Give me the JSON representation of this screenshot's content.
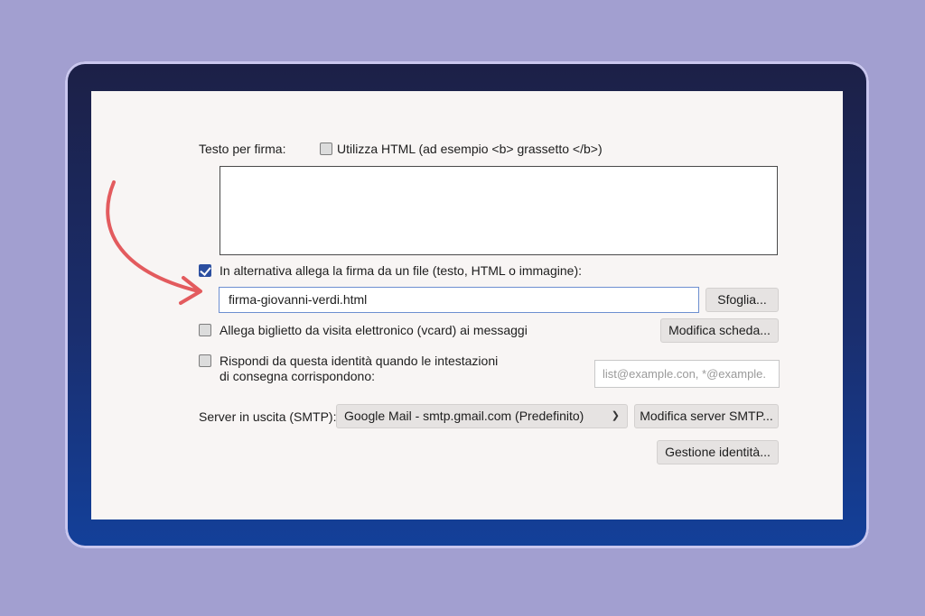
{
  "signature": {
    "label": "Testo per firma:",
    "use_html_label": "Utilizza HTML (ad esempio <b> grassetto </b>)",
    "use_html_checked": false,
    "text_value": ""
  },
  "attach_file": {
    "checked": true,
    "label": "In alternativa allega la firma da un file (testo, HTML o immagine):",
    "file_value": "firma-giovanni-verdi.html",
    "browse_label": "Sfoglia..."
  },
  "vcard": {
    "checked": false,
    "label": "Allega biglietto da visita elettronico (vcard) ai messaggi",
    "edit_label": "Modifica scheda..."
  },
  "reply_identity": {
    "checked": false,
    "label_line1": "Rispondi da questa identità quando le intestazioni",
    "label_line2": "di consegna corrispondono:",
    "placeholder": "list@example.con, *@example."
  },
  "smtp": {
    "label": "Server in uscita (SMTP):",
    "selected": "Google Mail - smtp.gmail.com (Predefinito)",
    "edit_label": "Modifica server SMTP..."
  },
  "manage_identities_label": "Gestione identità...",
  "colors": {
    "background": "#a29fd0",
    "accent": "#2c4fa0",
    "annotation_arrow": "#e35b5e"
  }
}
